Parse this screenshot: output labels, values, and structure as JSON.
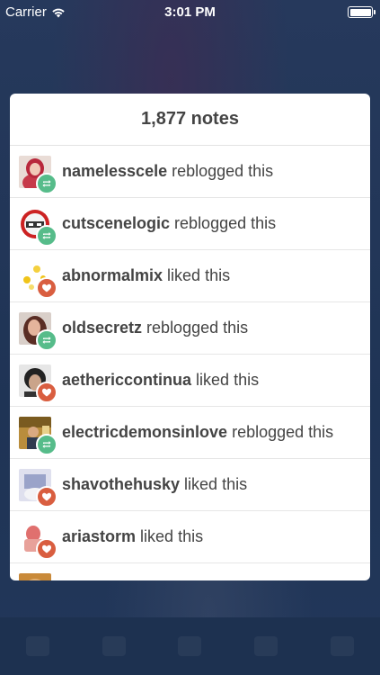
{
  "status_bar": {
    "carrier": "Carrier",
    "time": "3:01 PM"
  },
  "notes": {
    "title": "1,877 notes",
    "items": [
      {
        "username": "namelesscele",
        "action": "reblogged this",
        "type": "reblog"
      },
      {
        "username": "cutscenelogic",
        "action": "reblogged this",
        "type": "reblog"
      },
      {
        "username": "abnormalmix",
        "action": "liked this",
        "type": "like"
      },
      {
        "username": "oldsecretz",
        "action": "reblogged this",
        "type": "reblog"
      },
      {
        "username": "aethericcontinua",
        "action": "liked this",
        "type": "like"
      },
      {
        "username": "electricdemonsinlove",
        "action": "reblogged this",
        "type": "reblog"
      },
      {
        "username": "shavothehusky",
        "action": "liked this",
        "type": "like"
      },
      {
        "username": "ariastorm",
        "action": "liked this",
        "type": "like"
      }
    ]
  },
  "colors": {
    "reblog": "#56bc8a",
    "like": "#d95e40",
    "background": "#22375a"
  }
}
